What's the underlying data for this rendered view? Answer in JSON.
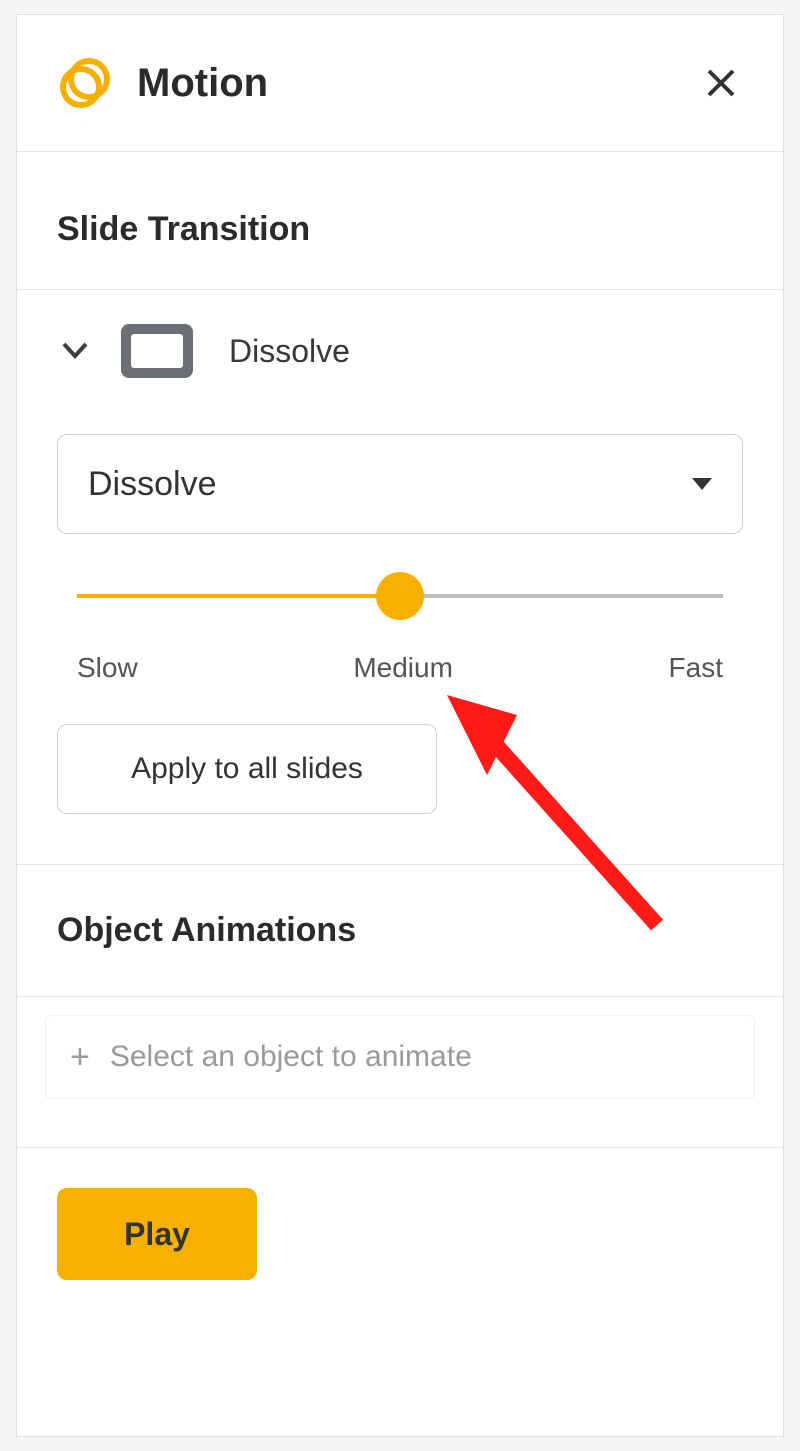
{
  "header": {
    "title": "Motion"
  },
  "transition": {
    "section_label": "Slide Transition",
    "current_name": "Dissolve",
    "dropdown_value": "Dissolve",
    "speed": {
      "value_percent": 50,
      "label_slow": "Slow",
      "label_medium": "Medium",
      "label_fast": "Fast"
    },
    "apply_all_label": "Apply to all slides"
  },
  "object_animations": {
    "section_label": "Object Animations",
    "placeholder": "Select an object to animate"
  },
  "play_label": "Play",
  "colors": {
    "accent": "#f6b100",
    "annotation_red": "#ff1a1a"
  }
}
